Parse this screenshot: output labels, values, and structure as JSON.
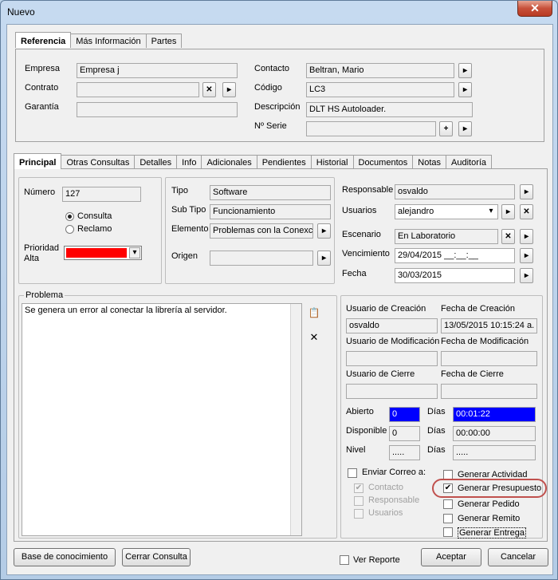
{
  "window": {
    "title": "Nuevo",
    "close_glyph": "✕"
  },
  "ref_tabs": [
    "Referencia",
    "Más Información",
    "Partes"
  ],
  "ref": {
    "empresa_label": "Empresa",
    "empresa_value": "Empresa j",
    "contrato_label": "Contrato",
    "contrato_value": "",
    "garantia_label": "Garantía",
    "garantia_value": "",
    "contacto_label": "Contacto",
    "contacto_value": "Beltran, Mario",
    "codigo_label": "Código",
    "codigo_value": "LC3",
    "descripcion_label": "Descripción",
    "descripcion_value": "DLT HS Autoloader.",
    "serie_label": "Nº Serie",
    "serie_value": ""
  },
  "main_tabs": [
    "Principal",
    "Otras Consultas",
    "Detalles",
    "Info",
    "Adicionales",
    "Pendientes",
    "Historial",
    "Documentos",
    "Notas",
    "Auditoría"
  ],
  "principal": {
    "numero_label": "Número",
    "numero_value": "127",
    "consulta_label": "Consulta",
    "reclamo_label": "Reclamo",
    "prioridad_label": "Prioridad",
    "prioridad_value": "Alta",
    "prioridad_color": "#ff0000",
    "tipo_label": "Tipo",
    "tipo_value": "Software",
    "subtipo_label": "Sub Tipo",
    "subtipo_value": "Funcionamiento",
    "elemento_label": "Elemento",
    "elemento_value": "Problemas con la Conexci",
    "origen_label": "Origen",
    "origen_value": "",
    "responsable_label": "Responsable",
    "responsable_value": "osvaldo",
    "usuarios_label": "Usuarios",
    "usuarios_value": "alejandro",
    "escenario_label": "Escenario",
    "escenario_value": "En Laboratorio",
    "vencimiento_label": "Vencimiento",
    "vencimiento_value": "29/04/2015 __:__:__",
    "fecha_label": "Fecha",
    "fecha_value": "30/03/2015"
  },
  "problema": {
    "label": "Problema",
    "text": "Se genera un error al conectar la librería al servidor."
  },
  "audit": {
    "usuario_creacion_label": "Usuario de Creación",
    "usuario_creacion_value": "osvaldo",
    "fecha_creacion_label": "Fecha de Creación",
    "fecha_creacion_value": "13/05/2015 10:15:24 a.",
    "usuario_mod_label": "Usuario de Modificación",
    "usuario_mod_value": "",
    "fecha_mod_label": "Fecha de Modificación",
    "fecha_mod_value": "",
    "usuario_cierre_label": "Usuario de Cierre",
    "usuario_cierre_value": "",
    "fecha_cierre_label": "Fecha de Cierre",
    "fecha_cierre_value": ""
  },
  "stats": {
    "abierto_label": "Abierto",
    "abierto_value": "0",
    "abierto_dias_value": "00:01:22",
    "disponible_label": "Disponible",
    "disponible_value": "0",
    "disponible_dias_value": "00:00:00",
    "nivel_label": "Nivel",
    "nivel_value": ".....",
    "nivel_dias_value": ".....",
    "dias_label": "Días"
  },
  "correo": {
    "enviar_label": "Enviar Correo a:",
    "contacto_label": "Contacto",
    "responsable_label": "Responsable",
    "usuarios_label": "Usuarios"
  },
  "generar": {
    "actividad": "Generar Actividad",
    "presupuesto": "Generar Presupuesto",
    "pedido": "Generar Pedido",
    "remito": "Generar Remito",
    "entrega": "Generar Entrega"
  },
  "footer": {
    "base_label": "Base de conocimiento",
    "cerrar_label": "Cerrar Consulta",
    "ver_reporte_label": "Ver Reporte",
    "aceptar_label": "Aceptar",
    "cancelar_label": "Cancelar"
  },
  "icons": {
    "arrow": "▸",
    "clear": "✕",
    "add": "+",
    "dropdown": "▾",
    "check": "✔",
    "paste": "📋"
  }
}
